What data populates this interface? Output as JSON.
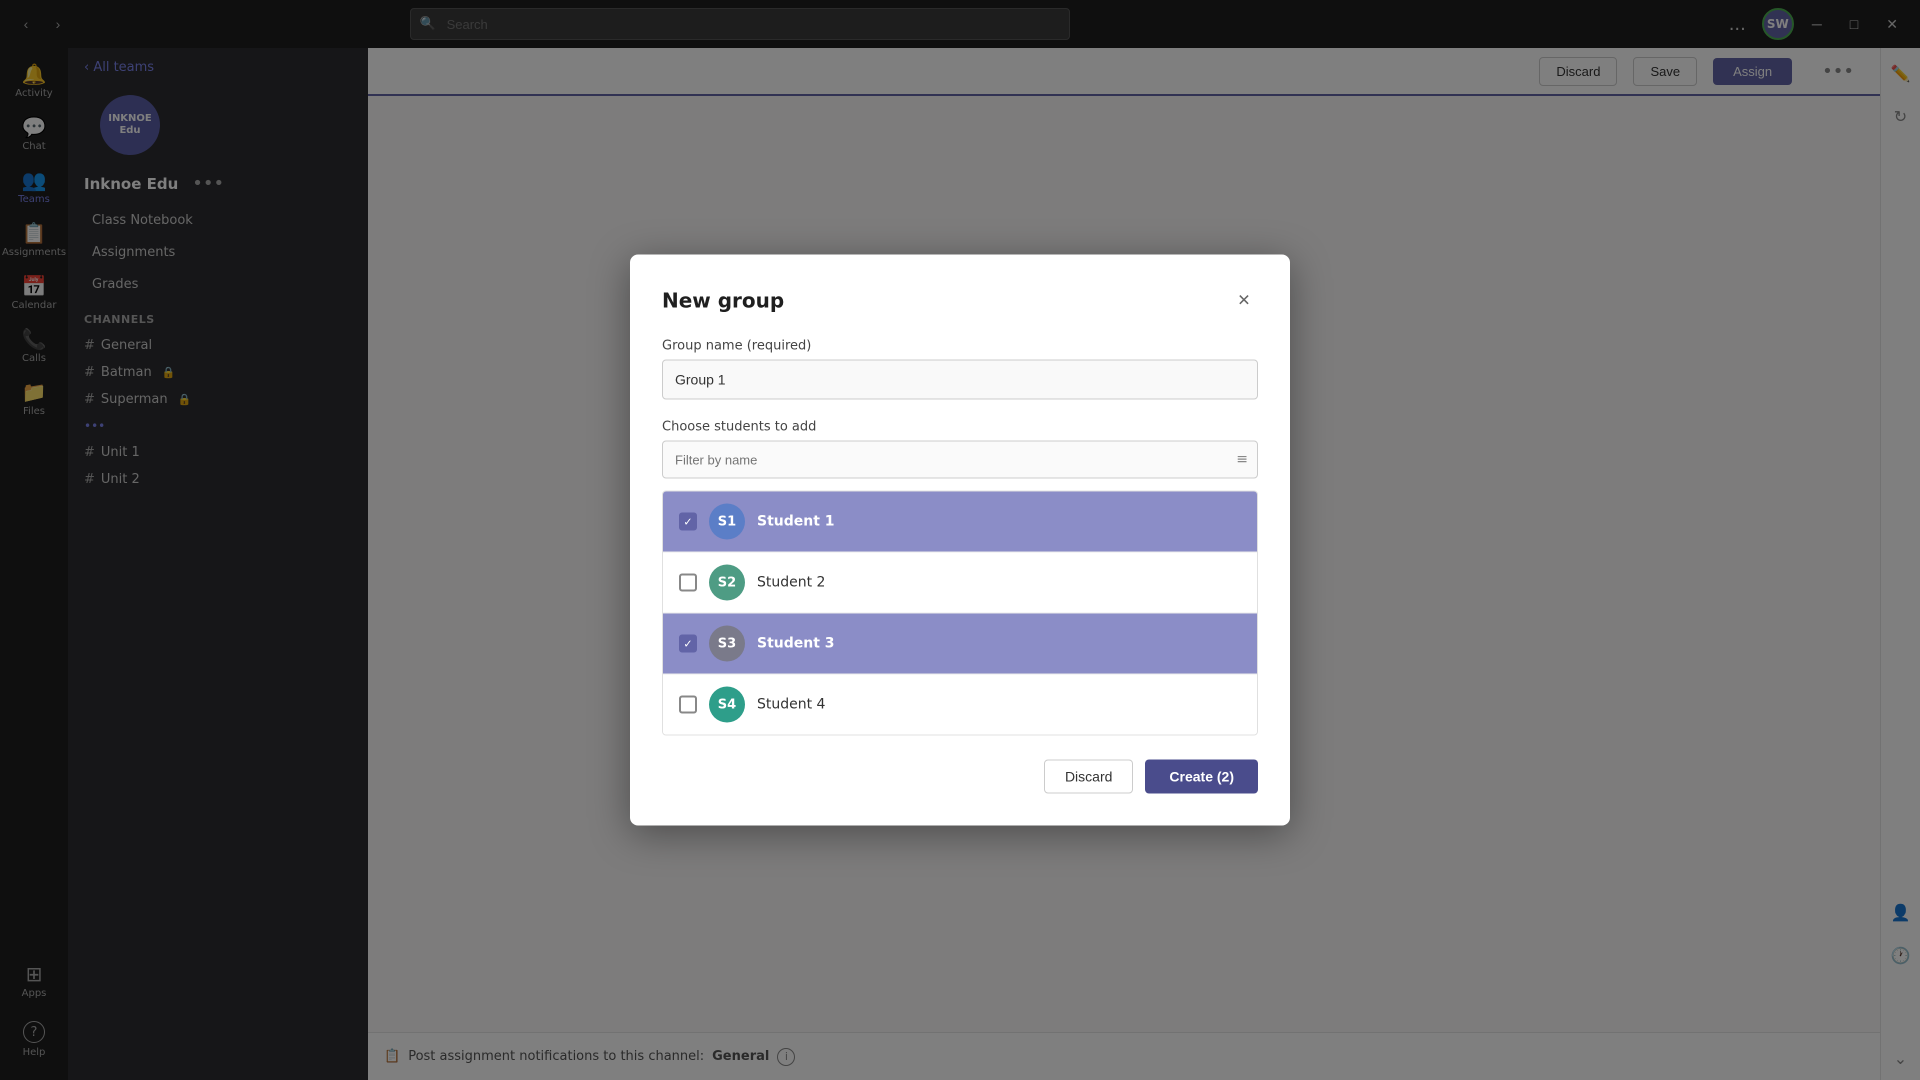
{
  "titleBar": {
    "searchPlaceholder": "Search",
    "moreLabel": "...",
    "avatarText": "SW",
    "minimizeLabel": "─",
    "maximizeLabel": "□",
    "closeLabel": "✕",
    "navBack": "‹",
    "navForward": "›"
  },
  "sidebar": {
    "items": [
      {
        "id": "activity",
        "label": "Activity",
        "icon": "🔔"
      },
      {
        "id": "chat",
        "label": "Chat",
        "icon": "💬"
      },
      {
        "id": "teams",
        "label": "Teams",
        "icon": "👥"
      },
      {
        "id": "assignments",
        "label": "Assignments",
        "icon": "📋"
      },
      {
        "id": "calendar",
        "label": "Calendar",
        "icon": "📅"
      },
      {
        "id": "calls",
        "label": "Calls",
        "icon": "📞"
      },
      {
        "id": "files",
        "label": "Files",
        "icon": "📁"
      }
    ],
    "bottomItems": [
      {
        "id": "apps",
        "label": "Apps",
        "icon": "⊞"
      },
      {
        "id": "help",
        "label": "Help",
        "icon": "?"
      }
    ]
  },
  "teamsPanel": {
    "backLabel": "‹ All teams",
    "teamLogoText": "INKNOE\nEdu",
    "teamName": "Inknoe Edu",
    "moreIcon": "•••",
    "navItems": [
      {
        "label": "Class Notebook"
      },
      {
        "label": "Assignments"
      },
      {
        "label": "Grades"
      }
    ],
    "channelsSection": "Channels",
    "channels": [
      {
        "label": "General",
        "icon": ""
      },
      {
        "label": "Batman",
        "icon": "🔒"
      },
      {
        "label": "Superman",
        "icon": "🔒"
      }
    ],
    "moreChannels": "•••",
    "channelItems": [
      {
        "label": "Unit 1"
      },
      {
        "label": "Unit 2"
      }
    ]
  },
  "toolbar": {
    "discardLabel": "Discard",
    "saveLabel": "Save",
    "assignLabel": "Assign"
  },
  "dialog": {
    "title": "New group",
    "closeIcon": "✕",
    "groupNameLabel": "Group name (required)",
    "groupNameValue": "Group 1",
    "chooseStudentsLabel": "Choose students to add",
    "filterPlaceholder": "Filter by name",
    "filterIcon": "≡",
    "students": [
      {
        "id": "s1",
        "initials": "S1",
        "name": "Student 1",
        "selected": true,
        "avatarClass": "avatar-s1"
      },
      {
        "id": "s2",
        "initials": "S2",
        "name": "Student 2",
        "selected": false,
        "avatarClass": "avatar-s2"
      },
      {
        "id": "s3",
        "initials": "S3",
        "name": "Student 3",
        "selected": true,
        "avatarClass": "avatar-s3"
      },
      {
        "id": "s4",
        "initials": "S4",
        "name": "Student 4",
        "selected": false,
        "avatarClass": "avatar-s4"
      }
    ],
    "discardLabel": "Discard",
    "createLabel": "Create (2)"
  },
  "bottomBar": {
    "notificationText": "Post assignment notifications to this channel:",
    "channelName": "General"
  }
}
